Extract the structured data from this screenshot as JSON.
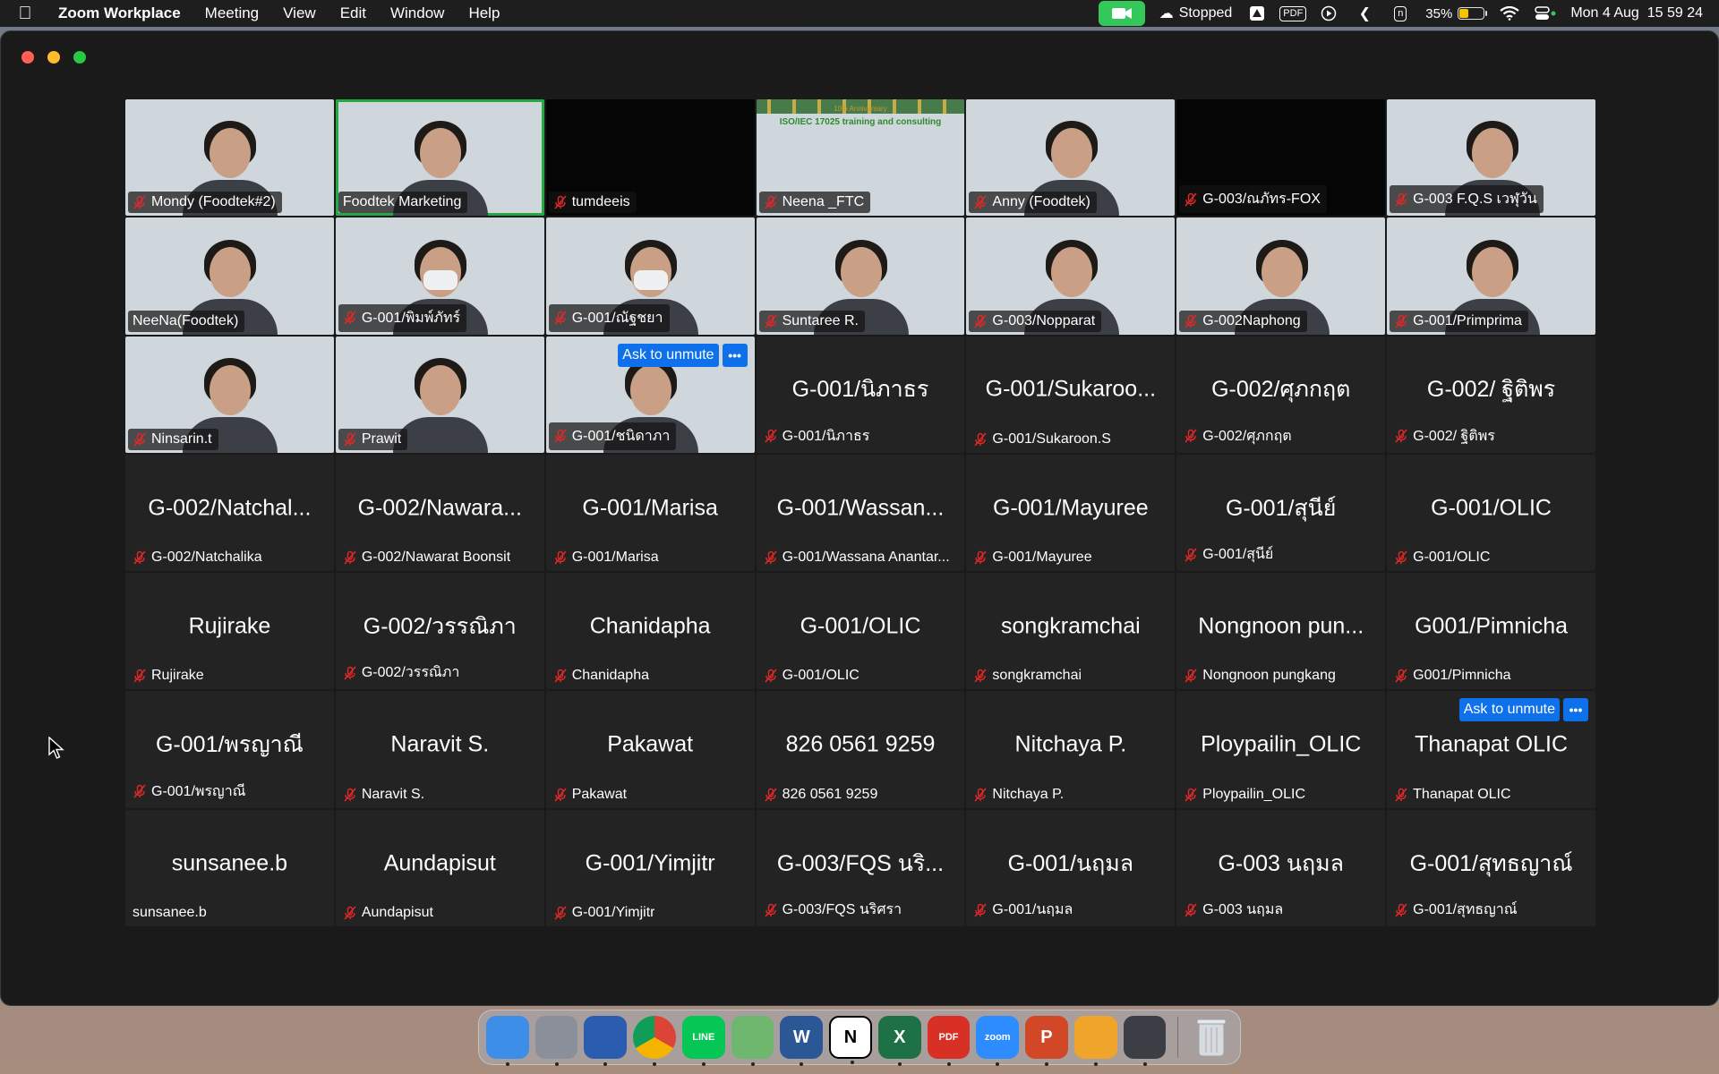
{
  "menubar": {
    "app_name": "Zoom Workplace",
    "menus": [
      "Meeting",
      "View",
      "Edit",
      "Window",
      "Help"
    ],
    "recording_status": "Stopped",
    "pdf_label": "PDF",
    "n_label": "n",
    "battery_percent": "35%",
    "battery_level": 0.35,
    "datetime": "Mon 4 Aug  15 59 24"
  },
  "gallery": {
    "tiles": [
      {
        "tag": "Mondy (Foodtek#2)",
        "muted": true,
        "kind": "video",
        "bg": "office"
      },
      {
        "tag": "Foodtek Marketing",
        "muted": false,
        "kind": "video",
        "bg": "office",
        "active": true
      },
      {
        "tag": "tumdeeis",
        "muted": true,
        "kind": "video-dark"
      },
      {
        "tag": "Neena _FTC",
        "muted": true,
        "kind": "video",
        "bg": "poster",
        "poster_title": "ISO/IEC 17025 training and consulting",
        "poster_sub": "10th Anniversary"
      },
      {
        "tag": "Anny (Foodtek)",
        "muted": true,
        "kind": "video",
        "bg": "office"
      },
      {
        "tag": "G-003/ณภัทร-FOX",
        "muted": true,
        "kind": "video-dark"
      },
      {
        "tag": "G-003 F.Q.S เวฬุวัน",
        "muted": true,
        "kind": "video",
        "bg": "blue"
      },
      {
        "tag": "NeeNa(Foodtek)",
        "muted": false,
        "kind": "video",
        "bg": "office"
      },
      {
        "tag": "G-001/พิมพ์ภัทร์",
        "muted": true,
        "kind": "video",
        "bg": "wall",
        "mask": true
      },
      {
        "tag": "G-001/ณัฐชยา",
        "muted": true,
        "kind": "video",
        "bg": "white",
        "mask": true
      },
      {
        "tag": "Suntaree R.",
        "muted": true,
        "kind": "video",
        "bg": "room"
      },
      {
        "tag": "G-003/Nopparat",
        "muted": true,
        "kind": "video",
        "bg": "wall"
      },
      {
        "tag": "G-002Naphong",
        "muted": true,
        "kind": "video",
        "bg": "warm"
      },
      {
        "tag": "G-001/Primprima",
        "muted": true,
        "kind": "video",
        "bg": "class"
      },
      {
        "tag": "Ninsarin.t",
        "muted": true,
        "kind": "video",
        "bg": "class"
      },
      {
        "tag": "Prawit",
        "muted": true,
        "kind": "video",
        "bg": "white"
      },
      {
        "tag": "G-001/ชนิดาภา",
        "muted": true,
        "kind": "video",
        "bg": "white",
        "unmute": true
      },
      {
        "big": "G-001/นิภาธร",
        "tag": "G-001/นิภาธร",
        "muted": true,
        "kind": "audio"
      },
      {
        "big": "G-001/Sukaroo...",
        "tag": "G-001/Sukaroon.S",
        "muted": true,
        "kind": "audio"
      },
      {
        "big": "G-002/ศุภกฤต",
        "tag": "G-002/ศุภกฤต",
        "muted": true,
        "kind": "audio"
      },
      {
        "big": "G-002/ ฐิติพร",
        "tag": "G-002/ ฐิติพร",
        "muted": true,
        "kind": "audio"
      },
      {
        "big": "G-002/Natchal...",
        "tag": "G-002/Natchalika",
        "muted": true,
        "kind": "audio"
      },
      {
        "big": "G-002/Nawara...",
        "tag": "G-002/Nawarat Boonsit",
        "muted": true,
        "kind": "audio"
      },
      {
        "big": "G-001/Marisa",
        "tag": "G-001/Marisa",
        "muted": true,
        "kind": "audio"
      },
      {
        "big": "G-001/Wassan...",
        "tag": "G-001/Wassana Anantar...",
        "muted": true,
        "kind": "audio"
      },
      {
        "big": "G-001/Mayuree",
        "tag": "G-001/Mayuree",
        "muted": true,
        "kind": "audio"
      },
      {
        "big": "G-001/สุนีย์",
        "tag": "G-001/สุนีย์",
        "muted": true,
        "kind": "audio"
      },
      {
        "big": "G-001/OLIC",
        "tag": "G-001/OLIC",
        "muted": true,
        "kind": "audio"
      },
      {
        "big": "Rujirake",
        "tag": "Rujirake",
        "muted": true,
        "kind": "audio"
      },
      {
        "big": "G-002/วรรณิภา",
        "tag": "G-002/วรรณิภา",
        "muted": true,
        "kind": "audio"
      },
      {
        "big": "Chanidapha",
        "tag": "Chanidapha",
        "muted": true,
        "kind": "audio"
      },
      {
        "big": "G-001/OLIC",
        "tag": "G-001/OLIC",
        "muted": true,
        "kind": "audio"
      },
      {
        "big": "songkramchai",
        "tag": "songkramchai",
        "muted": true,
        "kind": "audio"
      },
      {
        "big": "Nongnoon pun...",
        "tag": "Nongnoon pungkang",
        "muted": true,
        "kind": "audio"
      },
      {
        "big": "G001/Pimnicha",
        "tag": "G001/Pimnicha",
        "muted": true,
        "kind": "audio"
      },
      {
        "big": "G-001/พรญาณี",
        "tag": "G-001/พรญาณี",
        "muted": true,
        "kind": "audio"
      },
      {
        "big": "Naravit S.",
        "tag": "Naravit S.",
        "muted": true,
        "kind": "audio"
      },
      {
        "big": "Pakawat",
        "tag": "Pakawat",
        "muted": true,
        "kind": "audio"
      },
      {
        "big": "826 0561 9259",
        "tag": "826 0561 9259",
        "muted": true,
        "kind": "audio"
      },
      {
        "big": "Nitchaya P.",
        "tag": "Nitchaya P.",
        "muted": true,
        "kind": "audio"
      },
      {
        "big": "Ploypailin_OLIC",
        "tag": "Ploypailin_OLIC",
        "muted": true,
        "kind": "audio"
      },
      {
        "big": "Thanapat OLIC",
        "tag": "Thanapat OLIC",
        "muted": true,
        "kind": "audio",
        "unmute": true
      },
      {
        "big": "sunsanee.b",
        "tag": "sunsanee.b",
        "muted": false,
        "kind": "audio"
      },
      {
        "big": "Aundapisut",
        "tag": "Aundapisut",
        "muted": true,
        "kind": "audio"
      },
      {
        "big": "G-001/Yimjitr",
        "tag": "G-001/Yimjitr",
        "muted": true,
        "kind": "audio"
      },
      {
        "big": "G-003/FQS นริ...",
        "tag": "G-003/FQS นริศรา",
        "muted": true,
        "kind": "audio"
      },
      {
        "big": "G-001/นฤมล",
        "tag": "G-001/นฤมล",
        "muted": true,
        "kind": "audio"
      },
      {
        "big": "G-003 นฤมล",
        "tag": "G-003 นฤมล",
        "muted": true,
        "kind": "audio"
      },
      {
        "big": "G-001/สุทธญาณ์",
        "tag": "G-001/สุทธญาณ์",
        "muted": true,
        "kind": "audio"
      }
    ],
    "unmute_label": "Ask to unmute",
    "more_label": "•••"
  },
  "dock": {
    "apps": [
      {
        "name": "finder",
        "color": "#3d8ee8",
        "label": ""
      },
      {
        "name": "launchpad",
        "color": "#8a8f99",
        "label": ""
      },
      {
        "name": "thunderbird",
        "color": "#2a5db0",
        "label": ""
      },
      {
        "name": "chrome",
        "color": "#e8e8e8",
        "label": ""
      },
      {
        "name": "line",
        "color": "#06c755",
        "label": "LINE"
      },
      {
        "name": "maps",
        "color": "#6fb66f",
        "label": ""
      },
      {
        "name": "word",
        "color": "#2b5797",
        "label": "W"
      },
      {
        "name": "notion",
        "color": "#ffffff",
        "label": "N"
      },
      {
        "name": "excel",
        "color": "#1e7145",
        "label": "X"
      },
      {
        "name": "pdf",
        "color": "#d93025",
        "label": "PDF"
      },
      {
        "name": "zoom",
        "color": "#2d8cff",
        "label": "zoom"
      },
      {
        "name": "powerpoint",
        "color": "#d24726",
        "label": "P"
      },
      {
        "name": "vlc",
        "color": "#f0a52a",
        "label": ""
      },
      {
        "name": "quicktime",
        "color": "#3b3f45",
        "label": ""
      }
    ],
    "trash": {
      "name": "trash",
      "color": "#d7dadf"
    }
  }
}
